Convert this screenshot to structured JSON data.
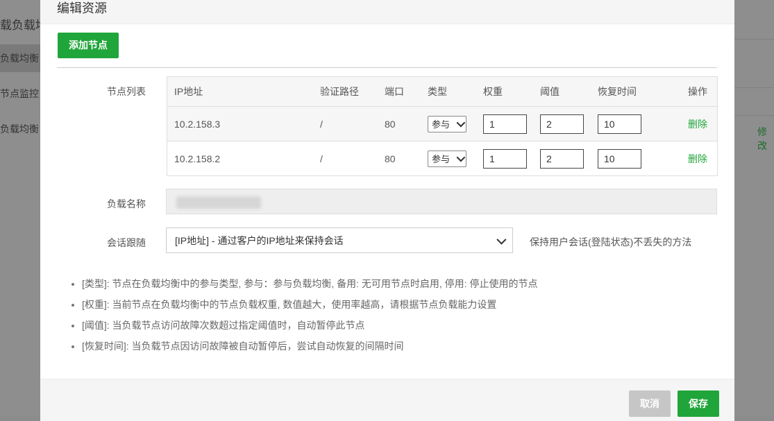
{
  "background": {
    "sidebar_title": "载负载均",
    "sidebar_items": [
      "负载均衡",
      "节点监控",
      "负载均衡"
    ],
    "right_link": "修改"
  },
  "modal": {
    "title": "编辑资源",
    "add_node_button": "添加节点",
    "node_list_label": "节点列表",
    "table": {
      "headers": [
        "IP地址",
        "验证路径",
        "端口",
        "类型",
        "权重",
        "阈值",
        "恢复时间",
        "操作"
      ],
      "rows": [
        {
          "ip": "10.2.158.3",
          "path": "/",
          "port": "80",
          "type": "参与",
          "weight": "1",
          "threshold": "2",
          "recovery": "10",
          "action": "删除"
        },
        {
          "ip": "10.2.158.2",
          "path": "/",
          "port": "80",
          "type": "参与",
          "weight": "1",
          "threshold": "2",
          "recovery": "10",
          "action": "删除"
        }
      ]
    },
    "load_name_label": "负载名称",
    "load_name_value": "",
    "session_label": "会话跟随",
    "session_selected": "[IP地址] - 通过客户的IP地址来保持会话",
    "session_hint": "保持用户会话(登陆状态)不丢失的方法",
    "notes": [
      "[类型]: 节点在负载均衡中的参与类型, 参与：参与负载均衡, 备用: 无可用节点时启用, 停用: 停止使用的节点",
      "[权重]: 当前节点在负载均衡中的节点负载权重, 数值越大，使用率越高，请根据节点负载能力设置",
      "[阈值]: 当负载节点访问故障次数超过指定阈值时，自动暂停此节点",
      "[恢复时间]: 当负载节点因访问故障被自动暂停后，尝试自动恢复的间隔时间"
    ],
    "cancel_button": "取消",
    "save_button": "保存"
  },
  "colors": {
    "accent": "#20a53a",
    "cancel": "#c6c6c6",
    "overlay": "#8e8e8e"
  }
}
